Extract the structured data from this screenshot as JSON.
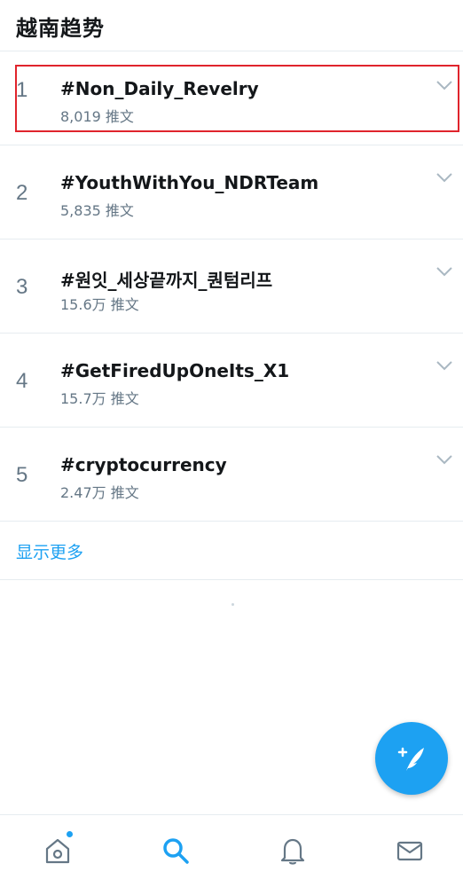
{
  "header": {
    "title": "越南趋势"
  },
  "trends": [
    {
      "rank": "1",
      "name": "#Non_Daily_Revelry",
      "count": "8,019 推文"
    },
    {
      "rank": "2",
      "name": "#YouthWithYou_NDRTeam",
      "count": "5,835 推文"
    },
    {
      "rank": "3",
      "name": "#원잇_세상끝까지_퀀텀리프",
      "count": "15.6万 推文"
    },
    {
      "rank": "4",
      "name": "#GetFiredUpOneIts_X1",
      "count": "15.7万 推文"
    },
    {
      "rank": "5",
      "name": "#cryptocurrency",
      "count": "2.47万 推文"
    }
  ],
  "show_more": {
    "label": "显示更多"
  },
  "fab": {
    "icon": "compose-tweet-icon"
  },
  "bottom_nav": [
    {
      "icon": "home-icon",
      "has_notification_dot": true
    },
    {
      "icon": "search-icon",
      "active": true
    },
    {
      "icon": "bell-icon"
    },
    {
      "icon": "mail-icon"
    }
  ],
  "colors": {
    "accent": "#1da1f2",
    "highlight_border": "#e0242c",
    "text_secondary": "#657786"
  }
}
